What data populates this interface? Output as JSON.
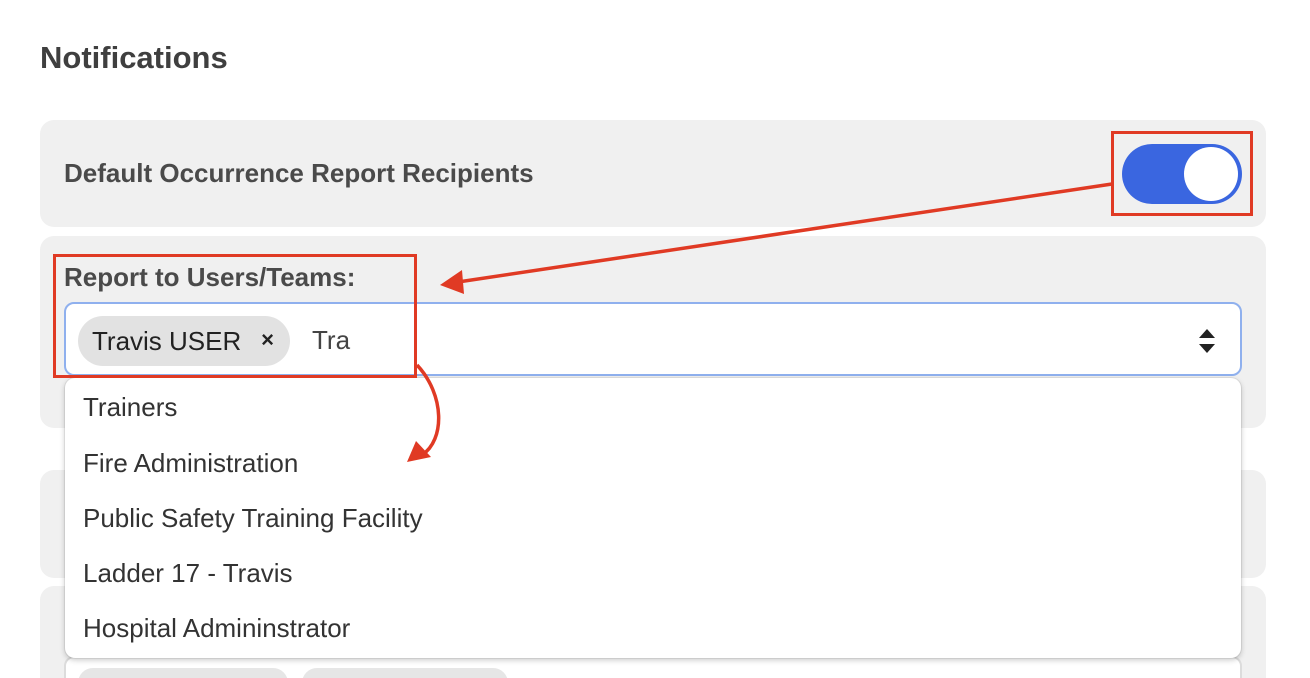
{
  "page": {
    "heading": "Notifications"
  },
  "default_recipients": {
    "label": "Default Occurrence Report Recipients",
    "enabled": true,
    "accent_color": "#3a66e0"
  },
  "report_to": {
    "label": "Report to Users/Teams:",
    "selected": [
      {
        "label": "Travis USER",
        "remove_glyph": "×"
      }
    ],
    "input_value": "Tra",
    "options": [
      {
        "label": "Trainers"
      },
      {
        "label": "Fire Administration"
      },
      {
        "label": "Public Safety Training Facility"
      },
      {
        "label": "Ladder 17 - Travis"
      },
      {
        "label": "Hospital Admininstrator"
      }
    ]
  },
  "annotation": {
    "color": "#e03a24"
  },
  "icons": {
    "toggle": "toggle-switch-icon",
    "sort": "sort-arrows-icon",
    "remove": "close-icon"
  }
}
